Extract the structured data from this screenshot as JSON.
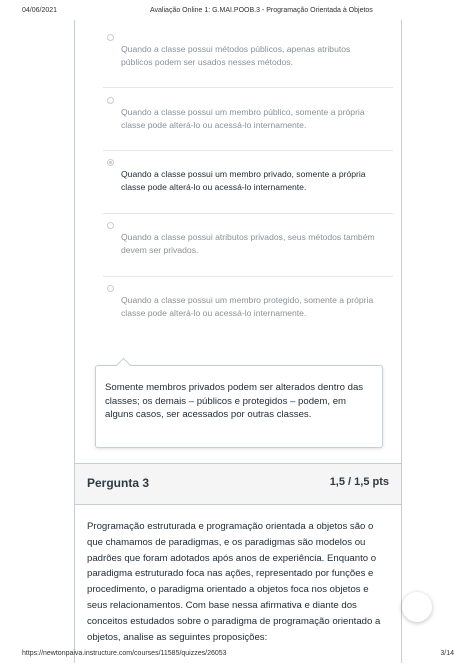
{
  "pdf_header": {
    "date": "04/06/2021",
    "title": "Avaliação Online 1: G.MAI.POOB.3 - Programação Orientada à Objetos"
  },
  "question2": {
    "answers": [
      {
        "text": "Quando a classe possui métodos públicos, apenas atributos públicos podem ser usados nesses métodos.",
        "selected": false
      },
      {
        "text": "Quando a classe possui um membro público, somente a própria classe pode alterá-lo ou acessá-lo internamente.",
        "selected": false
      },
      {
        "text": "Quando a classe possui um membro privado, somente a própria classe pode alterá-lo ou acessá-lo internamente.",
        "selected": true
      },
      {
        "text": "Quando a classe possui atributos privados, seus métodos também devem ser privados.",
        "selected": false
      },
      {
        "text": "Quando a classe possui um membro protegido, somente a própria classe pode alterá-lo ou acessá-lo internamente.",
        "selected": false
      }
    ],
    "feedback": "Somente membros privados podem ser alterados dentro das classes; os demais – públicos e protegidos – podem, em alguns casos, ser acessados por outras classes."
  },
  "question3": {
    "title": "Pergunta 3",
    "points": "1,5 / 1,5 pts",
    "body": "Programação estruturada e programação orientada a objetos são o que chamamos de paradigmas, e os paradigmas são modelos ou padrões que foram adotados após anos de experiência. Enquanto o paradigma estruturado foca nas ações, representado por funções e procedimento, o paradigma orientado a objetos foca nos objetos e seus relacionamentos. Com base nessa afirmativa e diante dos conceitos estudados sobre o paradigma de programação orientado a objetos, analise as seguintes proposições:"
  },
  "pdf_footer": {
    "url": "https://newtonpaiva.instructure.com/courses/11585/quizzes/26053",
    "page": "3/14"
  }
}
